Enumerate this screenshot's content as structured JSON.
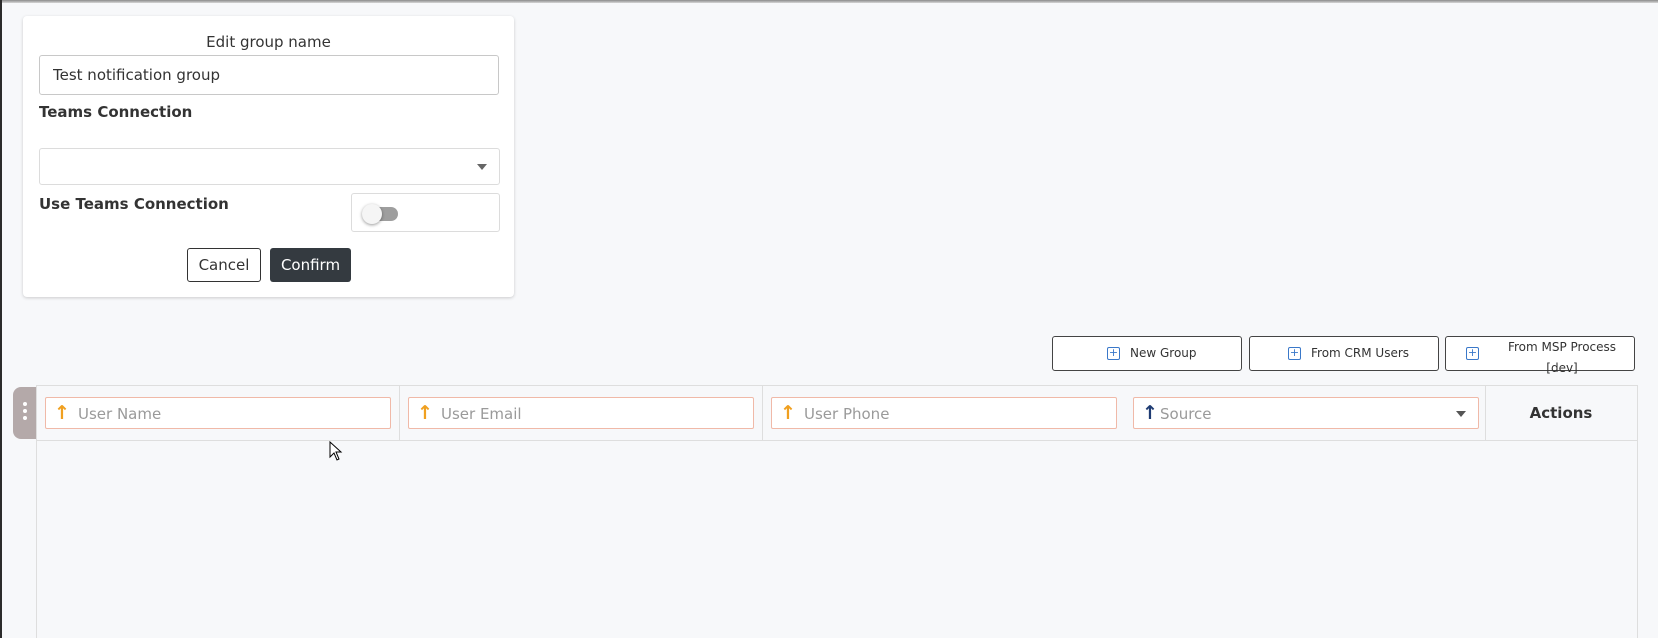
{
  "edit_card": {
    "title": "Edit group name",
    "group_name_value": "Test notification group",
    "teams_connection_label": "Teams Connection",
    "teams_connection_selected": "",
    "use_teams_connection_label": "Use Teams Connection",
    "use_teams_connection_on": false,
    "cancel_label": "Cancel",
    "confirm_label": "Confirm"
  },
  "toolbar": {
    "new_group_label": "New Group",
    "from_crm_users_label": "From CRM Users",
    "from_msp_process_line1": "From MSP Process",
    "from_msp_process_line2": "[dev]",
    "plus_icon": "plus-square-icon"
  },
  "table": {
    "filters": {
      "user_name_placeholder": "User Name",
      "user_email_placeholder": "User Email",
      "user_phone_placeholder": "User Phone",
      "source_placeholder": "Source"
    },
    "actions_header": "Actions",
    "rows": []
  },
  "colors": {
    "confirm_bg": "#343a40",
    "sort_arrow_active": "#f0a020",
    "sort_arrow_source": "#1f3c73",
    "filter_border": "#f0b9a8",
    "icon_blue": "#3a78c9"
  }
}
